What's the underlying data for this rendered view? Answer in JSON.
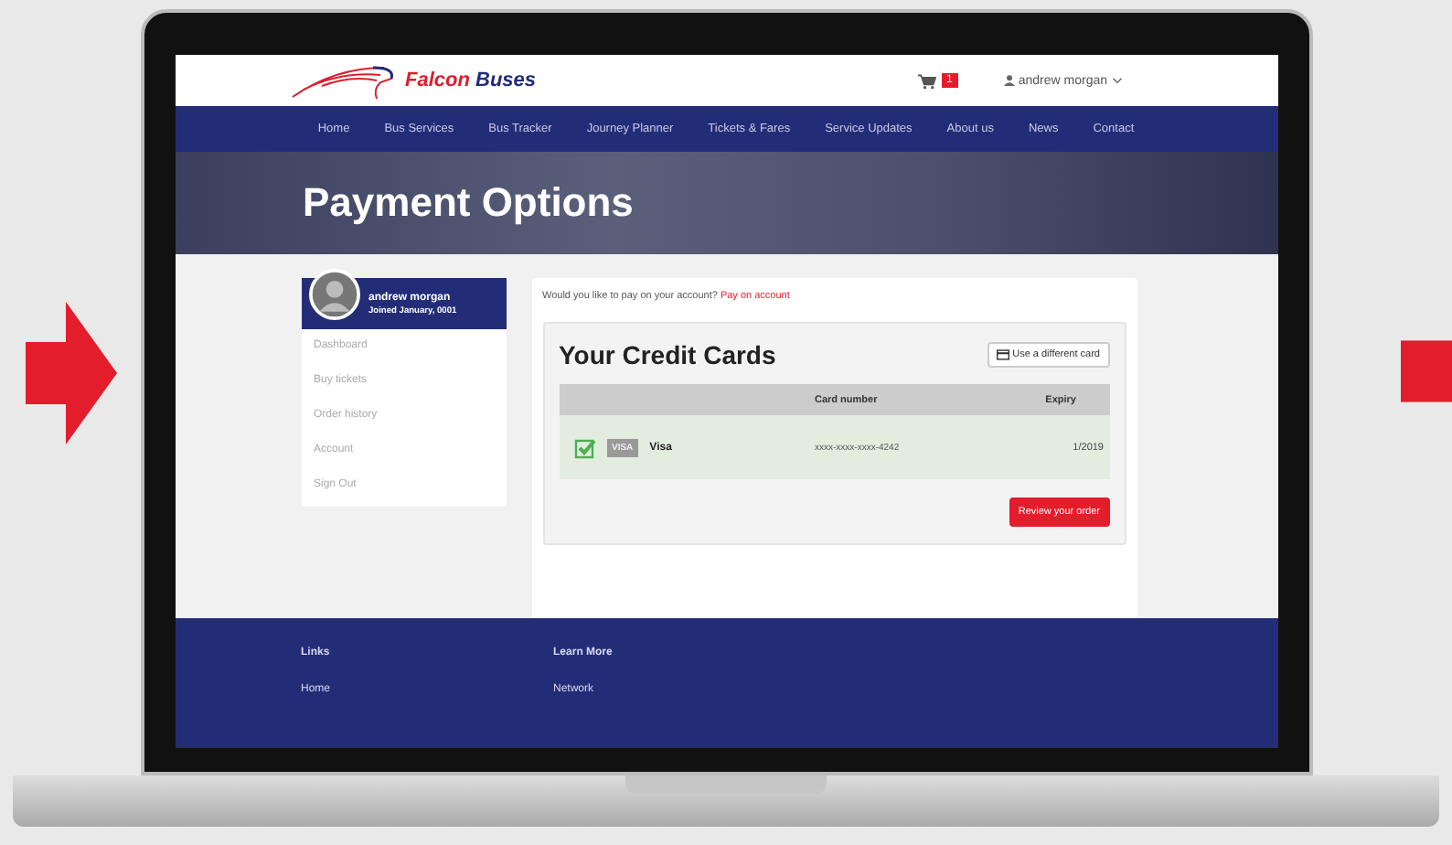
{
  "header": {
    "brand": [
      "Falcon",
      "Buses"
    ],
    "cart_count": "1",
    "user": "andrew morgan"
  },
  "nav": [
    "Home",
    "Bus Services",
    "Bus Tracker",
    "Journey Planner",
    "Tickets & Fares",
    "Service Updates",
    "About us",
    "News",
    "Contact"
  ],
  "hero": {
    "title": "Payment Options"
  },
  "profile": {
    "name": "andrew morgan",
    "joined": "Joined January, 0001"
  },
  "sidebar": {
    "items": [
      "Dashboard",
      "Buy tickets",
      "Order history",
      "Account",
      "Sign Out"
    ]
  },
  "account_prompt": {
    "text": "Would you like to pay on your account?",
    "link": "Pay on account"
  },
  "cards": {
    "title": "Your Credit Cards",
    "add_button": "Use a different card",
    "columns": [
      "Card number",
      "Expiry"
    ],
    "rows": [
      {
        "selected": true,
        "brand_badge": "VISA",
        "type": "Visa",
        "number": "xxxx-xxxx-xxxx-4242",
        "expiry": "1/2019"
      }
    ],
    "review_button": "Review your order"
  },
  "footer": {
    "columns": [
      {
        "heading": "Links",
        "items": [
          "Home"
        ]
      },
      {
        "heading": "Learn More",
        "items": [
          "Network"
        ]
      }
    ]
  }
}
